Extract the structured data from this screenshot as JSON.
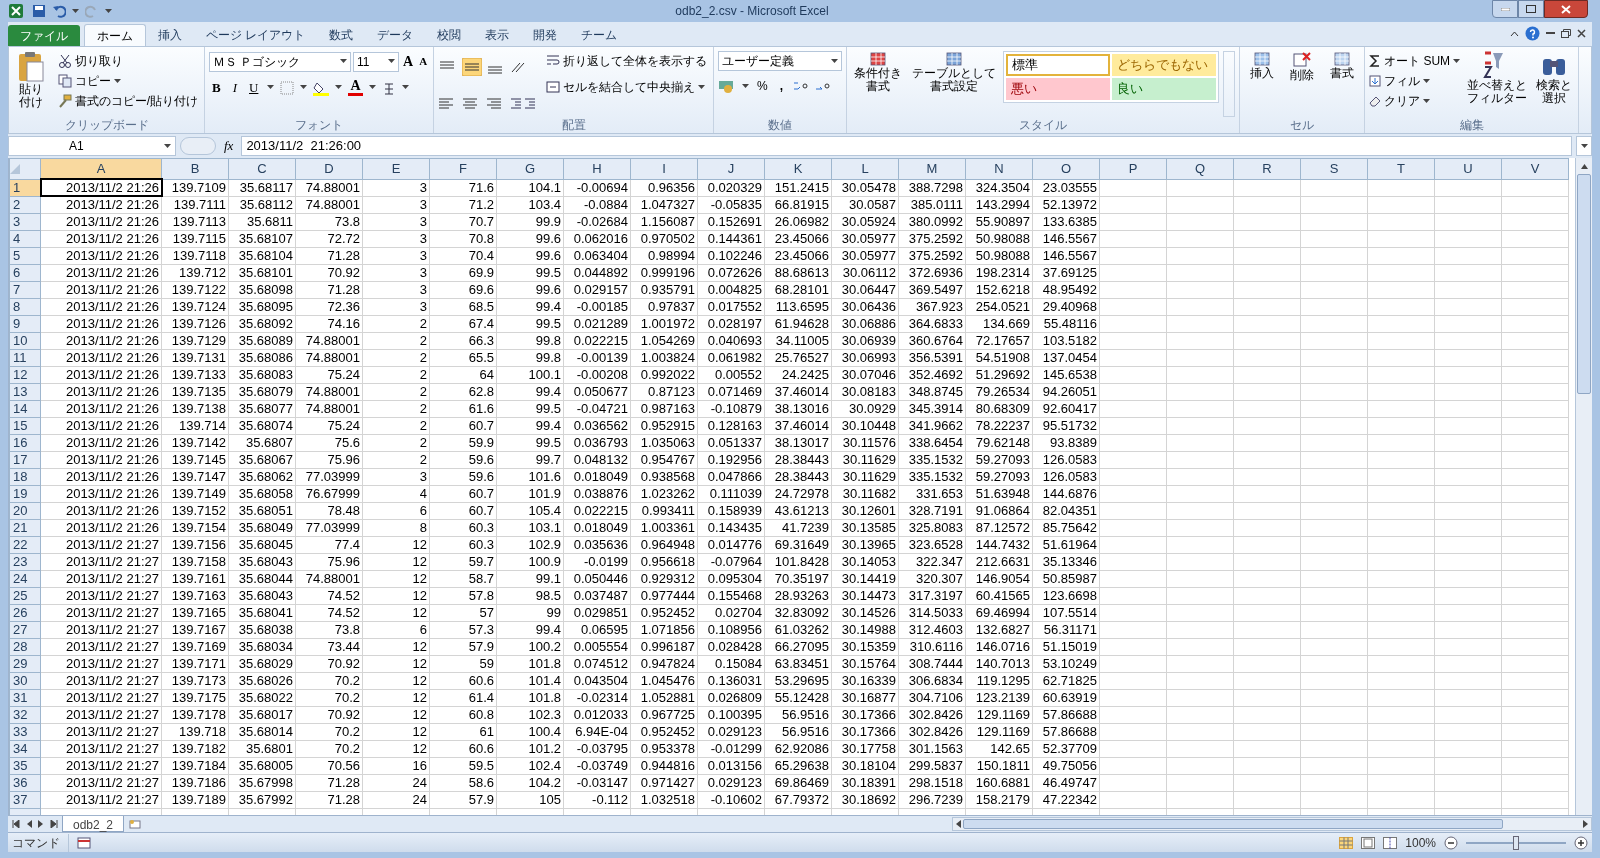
{
  "window": {
    "title": "odb2_2.csv - Microsoft Excel"
  },
  "ribbon_tabs": [
    {
      "label": "ファイル",
      "kind": "file",
      "selected": false
    },
    {
      "label": "ホーム",
      "kind": "tab",
      "selected": true
    },
    {
      "label": "挿入",
      "kind": "tab",
      "selected": false
    },
    {
      "label": "ページ レイアウト",
      "kind": "tab",
      "selected": false
    },
    {
      "label": "数式",
      "kind": "tab",
      "selected": false
    },
    {
      "label": "データ",
      "kind": "tab",
      "selected": false
    },
    {
      "label": "校閲",
      "kind": "tab",
      "selected": false
    },
    {
      "label": "表示",
      "kind": "tab",
      "selected": false
    },
    {
      "label": "開発",
      "kind": "tab",
      "selected": false
    },
    {
      "label": "チーム",
      "kind": "tab",
      "selected": false
    }
  ],
  "ribbon": {
    "clipboard": {
      "label": "クリップボード",
      "paste": "貼り付け",
      "cut": "切り取り",
      "copy": "コピー",
      "format_painter": "書式のコピー/貼り付け"
    },
    "font": {
      "label": "フォント",
      "name": "ＭＳ Ｐゴシック",
      "size": "11",
      "grow": "A",
      "shrink": "A",
      "bold": "B",
      "italic": "I",
      "underline": "U",
      "font_color": "A"
    },
    "alignment": {
      "label": "配置",
      "wrap": "折り返して全体を表示する",
      "merge": "セルを結合して中央揃え"
    },
    "number": {
      "label": "数値",
      "format": "ユーザー定義",
      "percent": "%",
      "comma": ","
    },
    "styles": {
      "label": "スタイル",
      "conditional": "条件付き書式",
      "table": "テーブルとして書式設定",
      "cell_styles": [
        {
          "label": "標準",
          "kind": "normal",
          "selected": true
        },
        {
          "label": "どちらでもない",
          "kind": "neutral",
          "selected": false
        },
        {
          "label": "悪い",
          "kind": "bad",
          "selected": false
        },
        {
          "label": "良い",
          "kind": "good",
          "selected": false
        }
      ]
    },
    "cells": {
      "label": "セル",
      "insert": "挿入",
      "delete": "削除",
      "format": "書式"
    },
    "editing": {
      "label": "編集",
      "autosum": "オート SUM",
      "fill": "フィル",
      "clear": "クリア",
      "sort": "並べ替えとフィルター",
      "find": "検索と選択"
    }
  },
  "formula_bar": {
    "name_box": "A1",
    "fx": "fx",
    "formula": "2013/11/2  21:26:00"
  },
  "columns": [
    {
      "label": "A",
      "selected": true
    },
    {
      "label": "B",
      "selected": false
    },
    {
      "label": "C",
      "selected": false
    },
    {
      "label": "D",
      "selected": false
    },
    {
      "label": "E",
      "selected": false
    },
    {
      "label": "F",
      "selected": false
    },
    {
      "label": "G",
      "selected": false
    },
    {
      "label": "H",
      "selected": false
    },
    {
      "label": "I",
      "selected": false
    },
    {
      "label": "J",
      "selected": false
    },
    {
      "label": "K",
      "selected": false
    },
    {
      "label": "L",
      "selected": false
    },
    {
      "label": "M",
      "selected": false
    },
    {
      "label": "N",
      "selected": false
    },
    {
      "label": "O",
      "selected": false
    },
    {
      "label": "P",
      "selected": false
    },
    {
      "label": "Q",
      "selected": false
    },
    {
      "label": "R",
      "selected": false
    },
    {
      "label": "S",
      "selected": false
    },
    {
      "label": "T",
      "selected": false
    },
    {
      "label": "U",
      "selected": false
    },
    {
      "label": "V",
      "selected": false
    }
  ],
  "rows": [
    {
      "number": "1",
      "selected": true,
      "cells": [
        "2013/11/2 21:26",
        "139.7109",
        "35.68117",
        "74.88001",
        "3",
        "71.6",
        "104.1",
        "-0.00694",
        "0.96356",
        "0.020329",
        "151.2415",
        "30.05478",
        "388.7298",
        "324.3504",
        "23.03555"
      ]
    },
    {
      "number": "2",
      "selected": false,
      "cells": [
        "2013/11/2 21:26",
        "139.7111",
        "35.68112",
        "74.88001",
        "3",
        "71.2",
        "103.4",
        "-0.0884",
        "1.047327",
        "-0.05835",
        "66.81915",
        "30.0587",
        "385.0111",
        "143.2994",
        "52.13972"
      ]
    },
    {
      "number": "3",
      "selected": false,
      "cells": [
        "2013/11/2 21:26",
        "139.7113",
        "35.6811",
        "73.8",
        "3",
        "70.7",
        "99.9",
        "-0.02684",
        "1.156087",
        "0.152691",
        "26.06982",
        "30.05924",
        "380.0992",
        "55.90897",
        "133.6385"
      ]
    },
    {
      "number": "4",
      "selected": false,
      "cells": [
        "2013/11/2 21:26",
        "139.7115",
        "35.68107",
        "72.72",
        "3",
        "70.8",
        "99.6",
        "0.062016",
        "0.970502",
        "0.144361",
        "23.45066",
        "30.05977",
        "375.2592",
        "50.98088",
        "146.5567"
      ]
    },
    {
      "number": "5",
      "selected": false,
      "cells": [
        "2013/11/2 21:26",
        "139.7118",
        "35.68104",
        "71.28",
        "3",
        "70.4",
        "99.6",
        "0.063404",
        "0.98994",
        "0.102246",
        "23.45066",
        "30.05977",
        "375.2592",
        "50.98088",
        "146.5567"
      ]
    },
    {
      "number": "6",
      "selected": false,
      "cells": [
        "2013/11/2 21:26",
        "139.712",
        "35.68101",
        "70.92",
        "3",
        "69.9",
        "99.5",
        "0.044892",
        "0.999196",
        "0.072626",
        "88.68613",
        "30.06112",
        "372.6936",
        "198.2314",
        "37.69125"
      ]
    },
    {
      "number": "7",
      "selected": false,
      "cells": [
        "2013/11/2 21:26",
        "139.7122",
        "35.68098",
        "71.28",
        "3",
        "69.6",
        "99.6",
        "0.029157",
        "0.935791",
        "0.004825",
        "68.28101",
        "30.06447",
        "369.5497",
        "152.6218",
        "48.95492"
      ]
    },
    {
      "number": "8",
      "selected": false,
      "cells": [
        "2013/11/2 21:26",
        "139.7124",
        "35.68095",
        "72.36",
        "3",
        "68.5",
        "99.4",
        "-0.00185",
        "0.97837",
        "0.017552",
        "113.6595",
        "30.06436",
        "367.923",
        "254.0521",
        "29.40968"
      ]
    },
    {
      "number": "9",
      "selected": false,
      "cells": [
        "2013/11/2 21:26",
        "139.7126",
        "35.68092",
        "74.16",
        "2",
        "67.4",
        "99.5",
        "0.021289",
        "1.001972",
        "0.028197",
        "61.94628",
        "30.06886",
        "364.6833",
        "134.669",
        "55.48116"
      ]
    },
    {
      "number": "10",
      "selected": false,
      "cells": [
        "2013/11/2 21:26",
        "139.7129",
        "35.68089",
        "74.88001",
        "2",
        "66.3",
        "99.8",
        "0.022215",
        "1.054269",
        "0.040693",
        "34.11005",
        "30.06939",
        "360.6764",
        "72.17657",
        "103.5182"
      ]
    },
    {
      "number": "11",
      "selected": false,
      "cells": [
        "2013/11/2 21:26",
        "139.7131",
        "35.68086",
        "74.88001",
        "2",
        "65.5",
        "99.8",
        "-0.00139",
        "1.003824",
        "0.061982",
        "25.76527",
        "30.06993",
        "356.5391",
        "54.51908",
        "137.0454"
      ]
    },
    {
      "number": "12",
      "selected": false,
      "cells": [
        "2013/11/2 21:26",
        "139.7133",
        "35.68083",
        "75.24",
        "2",
        "64",
        "100.1",
        "-0.00208",
        "0.992022",
        "0.00552",
        "24.2425",
        "30.07046",
        "352.4692",
        "51.29692",
        "145.6538"
      ]
    },
    {
      "number": "13",
      "selected": false,
      "cells": [
        "2013/11/2 21:26",
        "139.7135",
        "35.68079",
        "74.88001",
        "2",
        "62.8",
        "99.4",
        "0.050677",
        "0.87123",
        "0.071469",
        "37.46014",
        "30.08183",
        "348.8745",
        "79.26534",
        "94.26051"
      ]
    },
    {
      "number": "14",
      "selected": false,
      "cells": [
        "2013/11/2 21:26",
        "139.7138",
        "35.68077",
        "74.88001",
        "2",
        "61.6",
        "99.5",
        "-0.04721",
        "0.987163",
        "-0.10879",
        "38.13016",
        "30.0929",
        "345.3914",
        "80.68309",
        "92.60417"
      ]
    },
    {
      "number": "15",
      "selected": false,
      "cells": [
        "2013/11/2 21:26",
        "139.714",
        "35.68074",
        "75.24",
        "2",
        "60.7",
        "99.4",
        "0.036562",
        "0.952915",
        "0.128163",
        "37.46014",
        "30.10448",
        "341.9662",
        "78.22237",
        "95.51732"
      ]
    },
    {
      "number": "16",
      "selected": false,
      "cells": [
        "2013/11/2 21:26",
        "139.7142",
        "35.6807",
        "75.6",
        "2",
        "59.9",
        "99.5",
        "0.036793",
        "1.035063",
        "0.051337",
        "38.13017",
        "30.11576",
        "338.6454",
        "79.62148",
        "93.8389"
      ]
    },
    {
      "number": "17",
      "selected": false,
      "cells": [
        "2013/11/2 21:26",
        "139.7145",
        "35.68067",
        "75.96",
        "2",
        "59.6",
        "99.7",
        "0.048132",
        "0.954767",
        "0.192956",
        "28.38443",
        "30.11629",
        "335.1532",
        "59.27093",
        "126.0583"
      ]
    },
    {
      "number": "18",
      "selected": false,
      "cells": [
        "2013/11/2 21:26",
        "139.7147",
        "35.68062",
        "77.03999",
        "3",
        "59.6",
        "101.6",
        "0.018049",
        "0.938568",
        "0.047866",
        "28.38443",
        "30.11629",
        "335.1532",
        "59.27093",
        "126.0583"
      ]
    },
    {
      "number": "19",
      "selected": false,
      "cells": [
        "2013/11/2 21:26",
        "139.7149",
        "35.68058",
        "76.67999",
        "4",
        "60.7",
        "101.9",
        "0.038876",
        "1.023262",
        "0.111039",
        "24.72978",
        "30.11682",
        "331.653",
        "51.63948",
        "144.6876"
      ]
    },
    {
      "number": "20",
      "selected": false,
      "cells": [
        "2013/11/2 21:26",
        "139.7152",
        "35.68051",
        "78.48",
        "6",
        "60.7",
        "105.4",
        "0.022215",
        "0.993411",
        "0.158939",
        "43.61213",
        "30.12601",
        "328.7191",
        "91.06864",
        "82.04351"
      ]
    },
    {
      "number": "21",
      "selected": false,
      "cells": [
        "2013/11/2 21:26",
        "139.7154",
        "35.68049",
        "77.03999",
        "8",
        "60.3",
        "103.1",
        "0.018049",
        "1.003361",
        "0.143435",
        "41.7239",
        "30.13585",
        "325.8083",
        "87.12572",
        "85.75642"
      ]
    },
    {
      "number": "22",
      "selected": false,
      "cells": [
        "2013/11/2 21:27",
        "139.7156",
        "35.68045",
        "77.4",
        "12",
        "60.3",
        "102.9",
        "0.035636",
        "0.964948",
        "0.014776",
        "69.31649",
        "30.13965",
        "323.6528",
        "144.7432",
        "51.61964"
      ]
    },
    {
      "number": "23",
      "selected": false,
      "cells": [
        "2013/11/2 21:27",
        "139.7158",
        "35.68043",
        "75.96",
        "12",
        "59.7",
        "100.9",
        "-0.0199",
        "0.956618",
        "-0.07964",
        "101.8428",
        "30.14053",
        "322.347",
        "212.6631",
        "35.13346"
      ]
    },
    {
      "number": "24",
      "selected": false,
      "cells": [
        "2013/11/2 21:27",
        "139.7161",
        "35.68044",
        "74.88001",
        "12",
        "58.7",
        "99.1",
        "0.050446",
        "0.929312",
        "0.095304",
        "70.35197",
        "30.14419",
        "320.307",
        "146.9054",
        "50.85987"
      ]
    },
    {
      "number": "25",
      "selected": false,
      "cells": [
        "2013/11/2 21:27",
        "139.7163",
        "35.68043",
        "74.52",
        "12",
        "57.8",
        "98.5",
        "0.037487",
        "0.977444",
        "0.155468",
        "28.93263",
        "30.14473",
        "317.3197",
        "60.41565",
        "123.6698"
      ]
    },
    {
      "number": "26",
      "selected": false,
      "cells": [
        "2013/11/2 21:27",
        "139.7165",
        "35.68041",
        "74.52",
        "12",
        "57",
        "99",
        "0.029851",
        "0.952452",
        "0.02704",
        "32.83092",
        "30.14526",
        "314.5033",
        "69.46994",
        "107.5514"
      ]
    },
    {
      "number": "27",
      "selected": false,
      "cells": [
        "2013/11/2 21:27",
        "139.7167",
        "35.68038",
        "73.8",
        "6",
        "57.3",
        "99.4",
        "0.06595",
        "1.071856",
        "0.108956",
        "61.03262",
        "30.14988",
        "312.4603",
        "132.6827",
        "56.31171"
      ]
    },
    {
      "number": "28",
      "selected": false,
      "cells": [
        "2013/11/2 21:27",
        "139.7169",
        "35.68034",
        "73.44",
        "12",
        "57.9",
        "100.2",
        "0.005554",
        "0.996187",
        "0.028428",
        "66.27095",
        "30.15359",
        "310.6116",
        "146.0716",
        "51.15019"
      ]
    },
    {
      "number": "29",
      "selected": false,
      "cells": [
        "2013/11/2 21:27",
        "139.7171",
        "35.68029",
        "70.92",
        "12",
        "59",
        "101.8",
        "0.074512",
        "0.947824",
        "0.15084",
        "63.83451",
        "30.15764",
        "308.7444",
        "140.7013",
        "53.10249"
      ]
    },
    {
      "number": "30",
      "selected": false,
      "cells": [
        "2013/11/2 21:27",
        "139.7173",
        "35.68026",
        "70.2",
        "12",
        "60.6",
        "101.4",
        "0.043504",
        "1.045476",
        "0.136031",
        "53.29695",
        "30.16339",
        "306.6834",
        "119.1295",
        "62.71825"
      ]
    },
    {
      "number": "31",
      "selected": false,
      "cells": [
        "2013/11/2 21:27",
        "139.7175",
        "35.68022",
        "70.2",
        "12",
        "61.4",
        "101.8",
        "-0.02314",
        "1.052881",
        "0.026809",
        "55.12428",
        "30.16877",
        "304.7106",
        "123.2139",
        "60.63919"
      ]
    },
    {
      "number": "32",
      "selected": false,
      "cells": [
        "2013/11/2 21:27",
        "139.7178",
        "35.68017",
        "70.92",
        "12",
        "60.8",
        "102.3",
        "0.012033",
        "0.967725",
        "0.100395",
        "56.9516",
        "30.17366",
        "302.8426",
        "129.1169",
        "57.86688"
      ]
    },
    {
      "number": "33",
      "selected": false,
      "cells": [
        "2013/11/2 21:27",
        "139.718",
        "35.68014",
        "70.2",
        "12",
        "61",
        "100.4",
        "6.94E-04",
        "0.952452",
        "0.029123",
        "56.9516",
        "30.17366",
        "302.8426",
        "129.1169",
        "57.86688"
      ]
    },
    {
      "number": "34",
      "selected": false,
      "cells": [
        "2013/11/2 21:27",
        "139.7182",
        "35.6801",
        "70.2",
        "12",
        "60.6",
        "101.2",
        "-0.03795",
        "0.953378",
        "-0.01299",
        "62.92086",
        "30.17758",
        "301.1563",
        "142.65",
        "52.37709"
      ]
    },
    {
      "number": "35",
      "selected": false,
      "cells": [
        "2013/11/2 21:27",
        "139.7184",
        "35.68005",
        "70.56",
        "16",
        "59.5",
        "102.4",
        "-0.03749",
        "0.944816",
        "0.013156",
        "65.29638",
        "30.18104",
        "299.5837",
        "150.1811",
        "49.75056"
      ]
    },
    {
      "number": "36",
      "selected": false,
      "cells": [
        "2013/11/2 21:27",
        "139.7186",
        "35.67998",
        "71.28",
        "24",
        "58.6",
        "104.2",
        "-0.03147",
        "0.971427",
        "0.029123",
        "69.86469",
        "30.18391",
        "298.1518",
        "160.6881",
        "46.49747"
      ]
    },
    {
      "number": "37",
      "selected": false,
      "cells": [
        "2013/11/2 21:27",
        "139.7189",
        "35.67992",
        "71.28",
        "24",
        "57.9",
        "105",
        "-0.112",
        "1.032518",
        "-0.10602",
        "67.79372",
        "30.18692",
        "296.7239",
        "158.2179",
        "47.22342"
      ]
    }
  ],
  "sheet_tabs": [
    {
      "label": "odb2_2",
      "selected": true
    }
  ],
  "status_bar": {
    "mode": "コマンド",
    "zoom": "100%",
    "zoom_slider": {
      "level": 0.5
    }
  }
}
